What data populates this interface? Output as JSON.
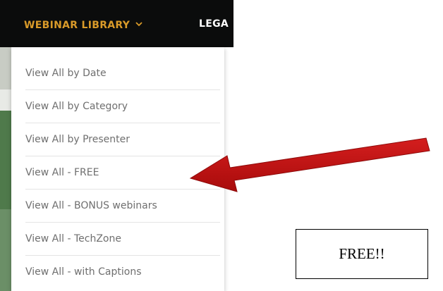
{
  "nav": {
    "webinar_library": "WEBINAR LIBRARY",
    "chevron_icon": "chevron-down",
    "next_item_partial": "LEGA"
  },
  "dropdown": {
    "items": [
      {
        "label": "View All by Date"
      },
      {
        "label": "View All by Category"
      },
      {
        "label": "View All by Presenter"
      },
      {
        "label": "View All - FREE"
      },
      {
        "label": "View All - BONUS webinars"
      },
      {
        "label": "View All - TechZone"
      },
      {
        "label": "View All - with Captions"
      }
    ]
  },
  "annotation": {
    "callout_text": "FREE!!",
    "arrow_color": "#c21010"
  },
  "colors": {
    "nav_background": "#0b0c0c",
    "nav_accent": "#d99a29",
    "menu_text": "#6f6f6f"
  }
}
